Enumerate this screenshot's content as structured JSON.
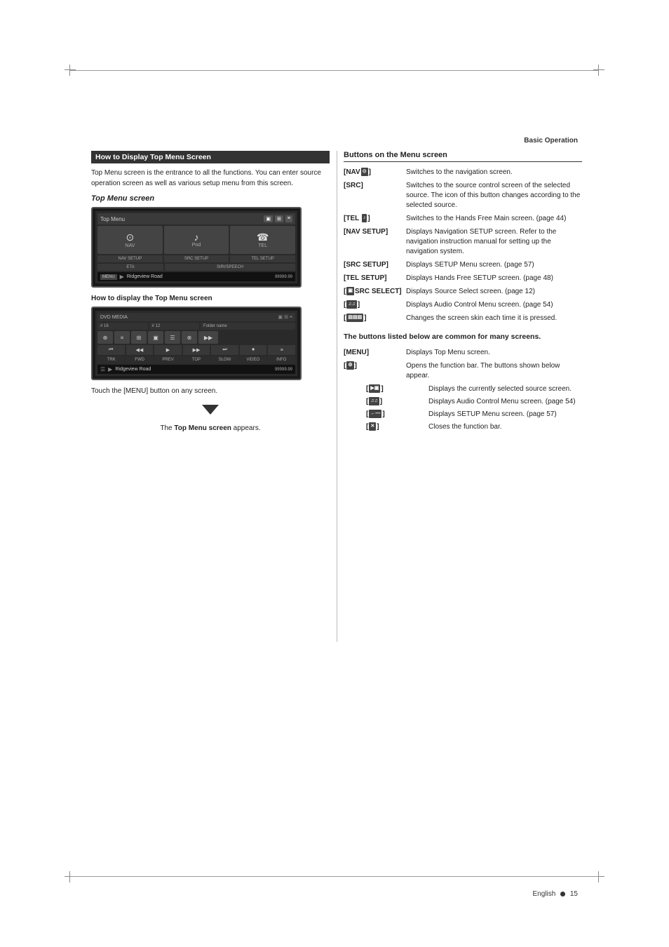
{
  "page": {
    "background": "#ffffff",
    "header": "Basic Operation",
    "page_number": "English  15"
  },
  "left_column": {
    "box_title": "How to Display Top Menu Screen",
    "intro_text": "Top Menu screen is the entrance to all the functions. You can enter source operation screen as well as various setup menu from this screen.",
    "screen_title": "Top Menu screen",
    "screen1": {
      "top_label": "Top Menu",
      "nav_buttons": [
        "NAV",
        "Pod",
        "TEL"
      ],
      "setup_buttons": [
        "NAV SETUP",
        "SRC SETUP",
        "TEL SETUP"
      ],
      "extra_row": [
        "ETA",
        "SIRI/SPEECH"
      ],
      "status_label": "MENU",
      "road": "Ridgeview Road",
      "number": "99999.99"
    },
    "how_to_title": "How to display the Top Menu screen",
    "screen2": {
      "top_label": "DVD MEDIA",
      "folder_label": "Folder",
      "folder_name_label": "Folder name",
      "time_label": "# 16",
      "time2_label": "# 12",
      "bottom_buttons": [
        "TRK",
        "FWD",
        "PREV",
        "TOP",
        "SLOW",
        "VIDEO",
        "INFO"
      ],
      "road": "Ridgeview Road",
      "number": "99999.99"
    },
    "touch_instruction": "Touch the [MENU] button on any screen.",
    "arrow_text": "",
    "appears_text": "The Top Menu screen appears."
  },
  "right_column": {
    "box_title": "Buttons on the Menu screen",
    "buttons": [
      {
        "label": "[NAV■]",
        "desc": "Switches to the navigation screen."
      },
      {
        "label": "[SRC]",
        "desc": "Switches to the source control screen of the selected source. The icon of this button changes according to the selected source."
      },
      {
        "label": "[TEL ♪]",
        "desc": "Switches to the Hands Free Main screen. (page 44)"
      },
      {
        "label": "[NAV SETUP]",
        "desc": "Displays Navigation SETUP screen. Refer to the navigation instruction manual for setting up the navigation system."
      },
      {
        "label": "[SRC SETUP]",
        "desc": "Displays SETUP Menu screen. (page 57)"
      },
      {
        "label": "[TEL SETUP]",
        "desc": "Displays Hands Free SETUP screen. (page 48)"
      },
      {
        "label": "[██SRC SELECT]",
        "desc": "Displays Source Select screen. (page 12)"
      },
      {
        "label": "[♪♪]",
        "desc": "Displays Audio Control Menu screen. (page 54)"
      },
      {
        "label": "[■■■]",
        "desc": "Changes the screen skin each time it is pressed."
      }
    ],
    "common_title": "The buttons listed below are common for many screens.",
    "common_buttons": [
      {
        "label": "[MENU]",
        "desc": "Displays Top Menu screen."
      },
      {
        "label": "[■]",
        "desc": "Opens the function bar. The buttons shown below appear."
      }
    ],
    "sub_buttons": [
      {
        "label": "[►■]",
        "desc": "Displays the currently selected source screen."
      },
      {
        "label": "[♪♪]",
        "desc": "Displays Audio Control Menu screen. (page 54)"
      },
      {
        "label": "[←—]",
        "desc": "Displays SETUP Menu screen. (page 57)"
      },
      {
        "label": "[✖]",
        "desc": "Closes the function bar."
      }
    ]
  }
}
